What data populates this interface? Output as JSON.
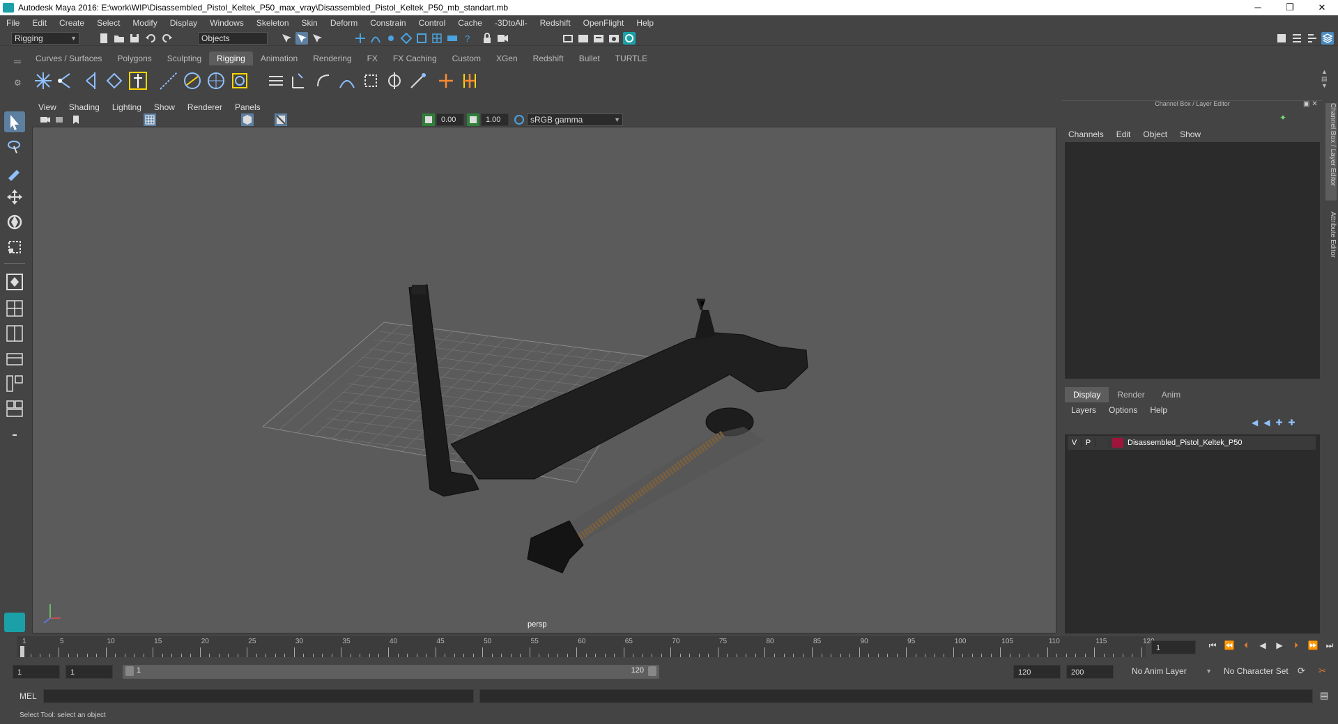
{
  "window": {
    "title": "Autodesk Maya 2016: E:\\work\\WIP\\Disassembled_Pistol_Keltek_P50_max_vray\\Disassembled_Pistol_Keltek_P50_mb_standart.mb",
    "minimize": "─",
    "restore": "❐",
    "close": "✕"
  },
  "menubar": [
    "File",
    "Edit",
    "Create",
    "Select",
    "Modify",
    "Display",
    "Windows",
    "Skeleton",
    "Skin",
    "Deform",
    "Constrain",
    "Control",
    "Cache",
    "-3DtoAll-",
    "Redshift",
    "OpenFlight",
    "Help"
  ],
  "statusline": {
    "mode": "Rigging",
    "selection_mode": "Objects"
  },
  "shelf_tabs": [
    "Curves / Surfaces",
    "Polygons",
    "Sculpting",
    "Rigging",
    "Animation",
    "Rendering",
    "FX",
    "FX Caching",
    "Custom",
    "XGen",
    "Redshift",
    "Bullet",
    "TURTLE"
  ],
  "shelf_active": "Rigging",
  "panel_menu": [
    "View",
    "Shading",
    "Lighting",
    "Show",
    "Renderer",
    "Panels"
  ],
  "panel_tools": {
    "exposure": "0.00",
    "gamma": "1.00",
    "colorspace": "sRGB gamma"
  },
  "viewport": {
    "camera": "persp"
  },
  "channel_box": {
    "header": "Channel Box / Layer Editor",
    "menu": [
      "Channels",
      "Edit",
      "Object",
      "Show"
    ]
  },
  "layer_editor": {
    "tabs": [
      "Display",
      "Render",
      "Anim"
    ],
    "active_tab": "Display",
    "menu": [
      "Layers",
      "Options",
      "Help"
    ],
    "layers": [
      {
        "v": "V",
        "p": "P",
        "name": "Disassembled_Pistol_Keltek_P50",
        "color": "#a0143c"
      }
    ]
  },
  "side_tabs": [
    "Channel Box / Layer Editor",
    "Attribute Editor"
  ],
  "timeline": {
    "ticks": [
      1,
      5,
      10,
      15,
      20,
      25,
      30,
      35,
      40,
      45,
      50,
      55,
      60,
      65,
      70,
      75,
      80,
      85,
      90,
      95,
      100,
      105,
      110,
      115,
      120
    ],
    "current_frame": "1"
  },
  "range": {
    "start": "1",
    "playback_start": "1",
    "slider_start": "1",
    "slider_end": "120",
    "playback_end": "120",
    "end": "200",
    "anim_layer": "No Anim Layer",
    "character_set": "No Character Set"
  },
  "command_line": {
    "label": "MEL"
  },
  "help_line": "Select Tool: select an object"
}
